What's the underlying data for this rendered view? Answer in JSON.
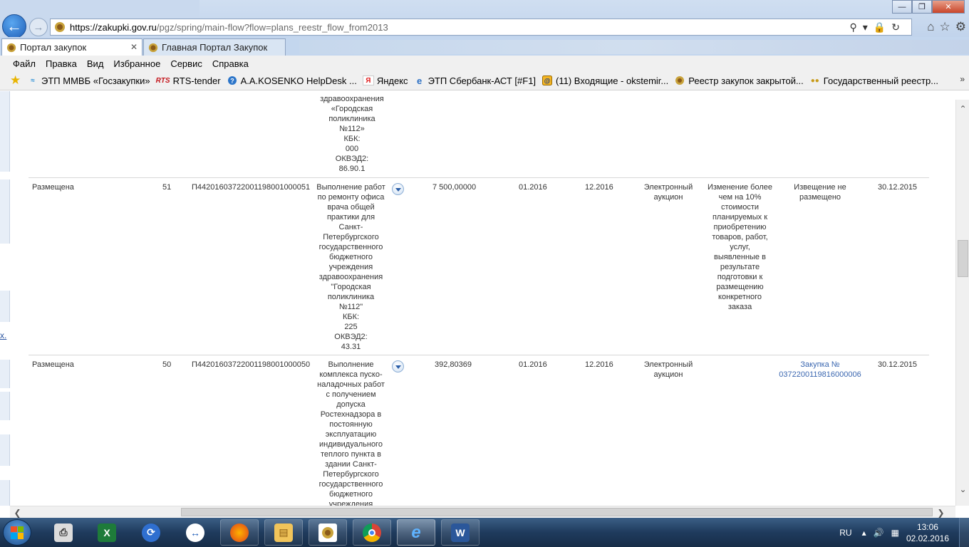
{
  "browser": {
    "url_host": "https://zakupki.gov.ru",
    "url_path": "/pgz/spring/main-flow?flow=plans_reestr_flow_from2013",
    "tabs": [
      {
        "label": "Портал закупок",
        "close": "✕"
      },
      {
        "label": "Главная Портал Закупок"
      }
    ],
    "menu": [
      "Файл",
      "Правка",
      "Вид",
      "Избранное",
      "Сервис",
      "Справка"
    ],
    "favorites": [
      {
        "label": "ЭТП ММВБ «Госзакупки»",
        "icon": "mmvb-icon"
      },
      {
        "label": "RTS-tender",
        "icon": "rts-icon"
      },
      {
        "label": "A.A.KOSENKO  HelpDesk ...",
        "icon": "helpdesk-icon"
      },
      {
        "label": "Яндекс",
        "icon": "yandex-icon"
      },
      {
        "label": "ЭТП Сбербанк-АСТ [#F1]",
        "icon": "ie-page-icon"
      },
      {
        "label": "(11) Входящие - okstemir...",
        "icon": "mail-icon"
      },
      {
        "label": "Реестр закупок закрытой...",
        "icon": "emblem-icon"
      },
      {
        "label": "Государственный реестр...",
        "icon": "coins-icon"
      }
    ],
    "more": "»"
  },
  "content": {
    "left_link": "x.",
    "top_fragment": [
      "здравоохранения",
      "«Городская",
      "поликлиника",
      "№112»",
      "КБК:",
      "000",
      "ОКВЭД2:",
      "86.90.1"
    ],
    "rows": [
      {
        "status": "Размещена",
        "num": "51",
        "code": "П44201603722001198001000051",
        "description": [
          "Выполнение работ",
          "по ремонту офиса",
          "врача общей",
          "практики для",
          "Санкт-",
          "Петербургского",
          "государственного",
          "бюджетного",
          "учреждения",
          "здравоохранения",
          "\"Городская",
          "поликлиника",
          "№112\"",
          "КБК:",
          "225",
          "ОКВЭД2:",
          "43.31"
        ],
        "amount": "7 500,00000",
        "start": "01.2016",
        "end": "12.2016",
        "method": [
          "Электронный",
          "аукцион"
        ],
        "reason": [
          "Изменение более",
          "чем на 10%",
          "стоимости",
          "планируемых к",
          "приобретению",
          "товаров, работ,",
          "услуг,",
          "выявленные в",
          "результате",
          "подготовки к",
          "размещению",
          "конкретного",
          "заказа"
        ],
        "notice": [
          "Извещение не",
          "размещено"
        ],
        "date": "30.12.2015"
      },
      {
        "status": "Размещена",
        "num": "50",
        "code": "П44201603722001198001000050",
        "description": [
          "Выполнение",
          "комплекса пуско-",
          "наладочных работ",
          "с получением",
          "допуска",
          "Ростехнадзора в",
          "постоянную",
          "эксплуатацию",
          "индивидуального",
          "теплого пункта в",
          "здании Санкт-",
          "Петербургского",
          "государственного",
          "бюджетного",
          "учреждения"
        ],
        "amount": "392,80369",
        "start": "01.2016",
        "end": "12.2016",
        "method": [
          "Электронный",
          "аукцион"
        ],
        "reason": [],
        "notice": [
          "Закупка №",
          "0372200119816000006"
        ],
        "date": "30.12.2015"
      }
    ]
  },
  "taskbar": {
    "apps": [
      "printer",
      "excel",
      "app-blue",
      "app-teamviewer",
      "firefox",
      "explorer",
      "emblem",
      "chrome",
      "ie",
      "word"
    ],
    "lang": "RU",
    "time": "13:06",
    "date": "02.02.2016"
  }
}
